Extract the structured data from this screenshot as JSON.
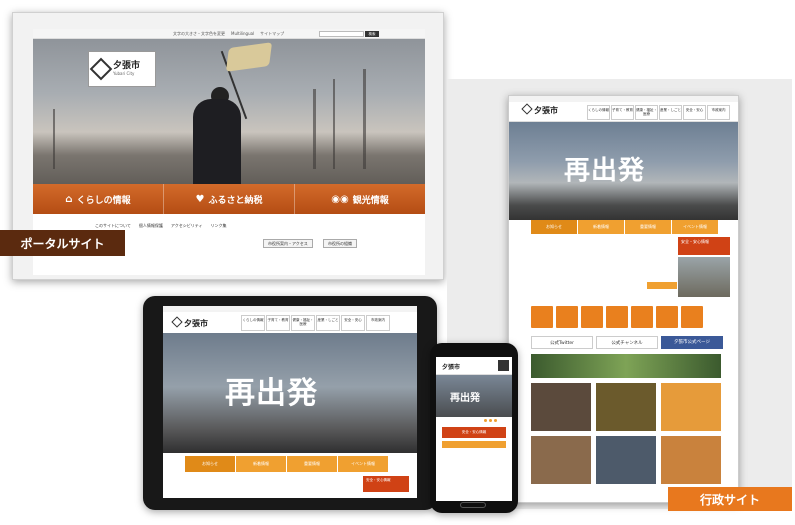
{
  "labels": {
    "portal": "ポータルサイト",
    "admin": "行政サイト"
  },
  "portal": {
    "top_links": [
      "文字の大きさ・文字色を変更",
      "Multilingual",
      "サイトマップ"
    ],
    "search_button": "検索",
    "logo_name": "夕張市",
    "logo_sub": "Yubari City",
    "nav": [
      {
        "icon": "home-icon",
        "label": "くらしの情報"
      },
      {
        "icon": "heart-icon",
        "label": "ふるさと納税"
      },
      {
        "icon": "binoculars-icon",
        "label": "観光情報"
      }
    ],
    "sub_links": [
      "このサイトについて",
      "個人情報保護",
      "アクセシビリティ",
      "リンク集"
    ],
    "buttons": [
      "市役所案内・アクセス",
      "市役所の組織"
    ]
  },
  "admin": {
    "logo_name": "夕張市",
    "hero_title": "再出発",
    "menu": [
      "くらしの情報",
      "子育て・教育",
      "健康・福祉・医療",
      "産業・しごと",
      "安全・安心",
      "市政案内"
    ],
    "tabs": [
      "お知らせ",
      "新着情報",
      "重要情報",
      "イベント情報"
    ],
    "emergency": "安全・安心情報",
    "social": [
      "公式Twitter",
      "公式チャンネル",
      "夕張市公式ページ"
    ]
  },
  "tablet": {
    "logo_name": "夕張市",
    "hero_title": "再出発",
    "menu": [
      "くらしの情報",
      "子育て・教育",
      "健康・福祉・医療",
      "産業・しごと",
      "安全・安心",
      "市政案内"
    ],
    "tabs": [
      "お知らせ",
      "新着情報",
      "重要情報",
      "イベント情報"
    ],
    "emergency": "安全・安心情報"
  },
  "phone": {
    "logo_name": "夕張市",
    "hero_title": "再出発",
    "emergency": "安全・安心情報"
  }
}
